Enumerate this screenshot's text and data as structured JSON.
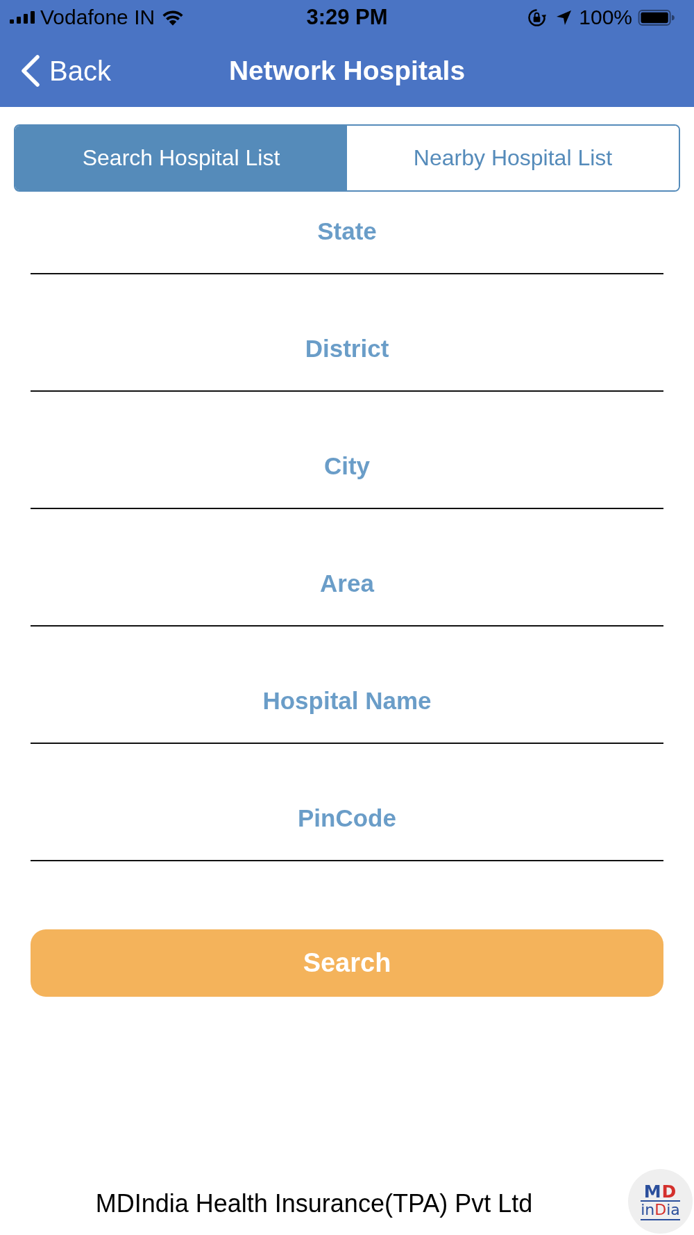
{
  "status_bar": {
    "carrier": "Vodafone IN",
    "time": "3:29 PM",
    "battery": "100%"
  },
  "nav_bar": {
    "back": "Back",
    "title": "Network Hospitals"
  },
  "tabs": [
    {
      "label": "Search Hospital List",
      "selected": true
    },
    {
      "label": "Nearby Hospital List",
      "selected": false
    }
  ],
  "fields": [
    {
      "placeholder": "State"
    },
    {
      "placeholder": "District"
    },
    {
      "placeholder": "City"
    },
    {
      "placeholder": "Area"
    },
    {
      "placeholder": "Hospital Name"
    },
    {
      "placeholder": "PinCode"
    }
  ],
  "search_button": "Search",
  "footer": {
    "company": "MDIndia Health Insurance(TPA) Pvt Ltd",
    "logo": [
      [
        {
          "text": "M",
          "color": "#2b4f9c"
        },
        {
          "text": "D",
          "color": "#d4302c"
        }
      ],
      [
        {
          "text": "in",
          "color": "#2b4f9c"
        },
        {
          "text": "D",
          "color": "#d4302c"
        },
        {
          "text": "ia",
          "color": "#2b4f9c"
        }
      ]
    ]
  }
}
